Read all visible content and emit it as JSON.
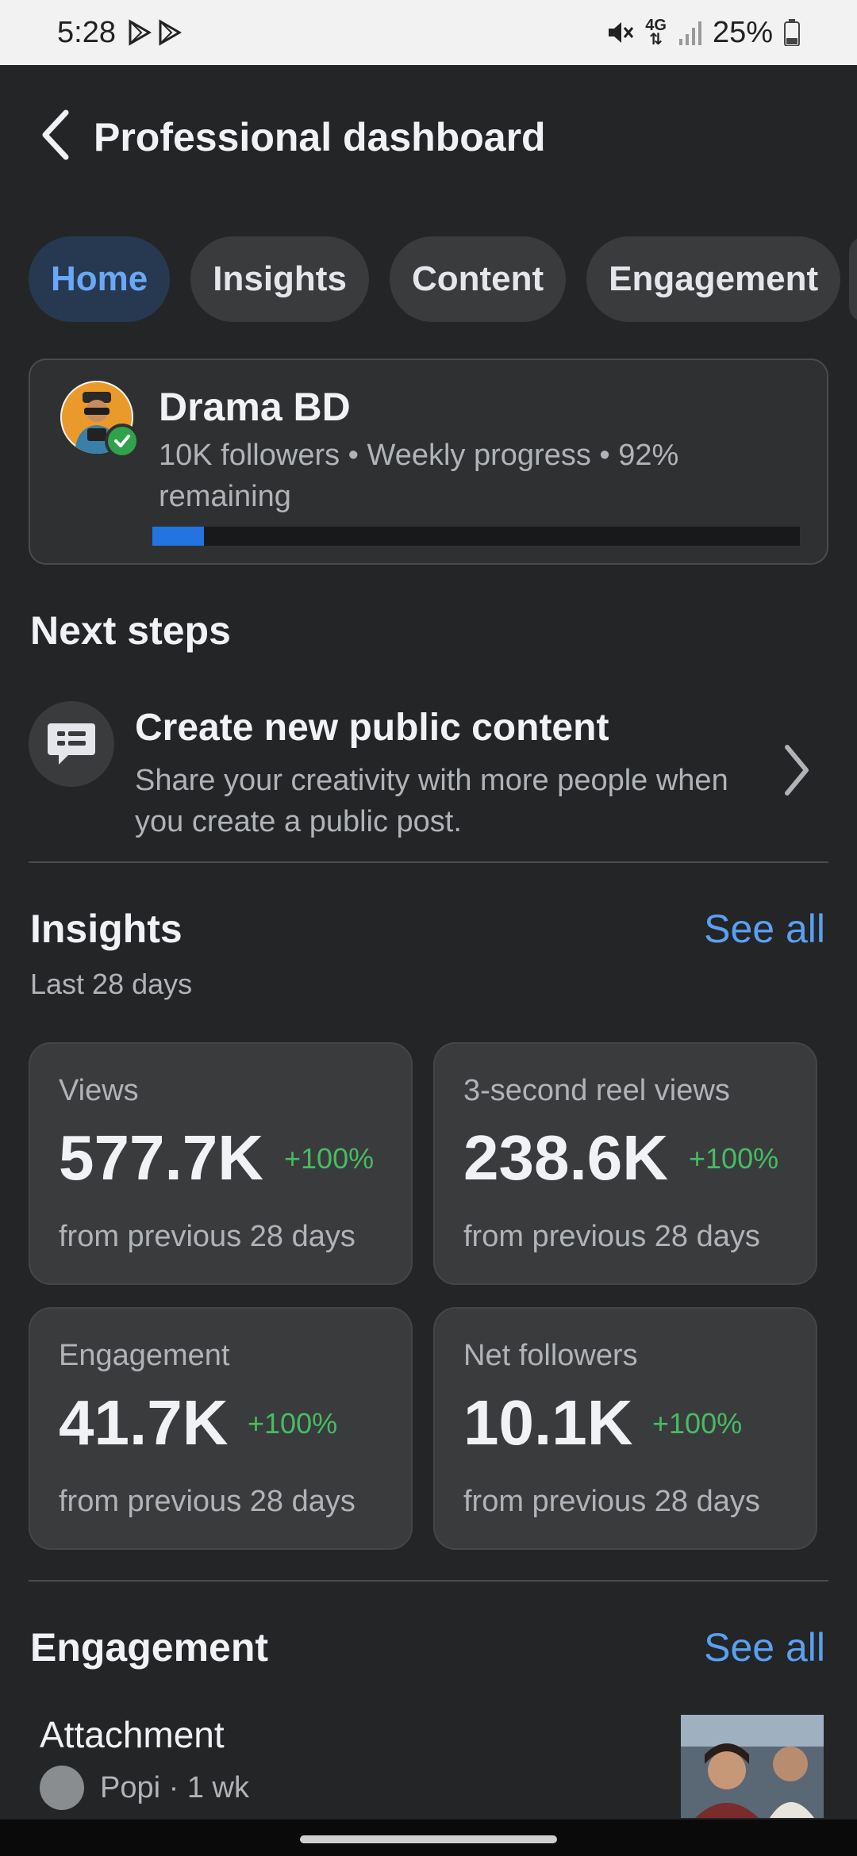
{
  "status_bar": {
    "time": "5:28",
    "network": "4G",
    "battery": "25%",
    "icons": [
      "play-store-icon",
      "play-store-icon",
      "mute-icon",
      "network-4g-icon",
      "signal-icon",
      "battery-icon"
    ]
  },
  "header": {
    "title": "Professional dashboard",
    "back_icon": "chevron-left-icon"
  },
  "tabs": [
    {
      "label": "Home",
      "active": true
    },
    {
      "label": "Insights",
      "active": false
    },
    {
      "label": "Content",
      "active": false
    },
    {
      "label": "Engagement",
      "active": false
    }
  ],
  "profile": {
    "name": "Drama BD",
    "meta": "10K followers • Weekly progress • 92% remaining",
    "progress_fraction": 0.08
  },
  "next_steps": {
    "title": "Next steps",
    "item": {
      "icon": "message-square-icon",
      "title": "Create new public content",
      "description": "Share your creativity with more people when you create a public post."
    }
  },
  "insights": {
    "title": "Insights",
    "see_all": "See all",
    "subtitle": "Last 28 days",
    "metrics": [
      {
        "label": "Views",
        "value": "577.7K",
        "change": "+100%",
        "from": "from previous 28 days"
      },
      {
        "label": "3-second reel views",
        "value": "238.6K",
        "change": "+100%",
        "from": "from previous 28 days"
      },
      {
        "label": "Engagement",
        "value": "41.7K",
        "change": "+100%",
        "from": "from previous 28 days"
      },
      {
        "label": "Net followers",
        "value": "10.1K",
        "change": "+100%",
        "from": "from previous 28 days"
      }
    ]
  },
  "engagement": {
    "title": "Engagement",
    "see_all": "See all",
    "item": {
      "name": "Attachment",
      "meta": "Popi · 1 wk"
    }
  },
  "colors": {
    "background": "#242526",
    "card": "#3a3b3c",
    "accent_blue": "#5aa0f2",
    "active_tab_bg": "#263951",
    "positive_green": "#45bd62"
  }
}
